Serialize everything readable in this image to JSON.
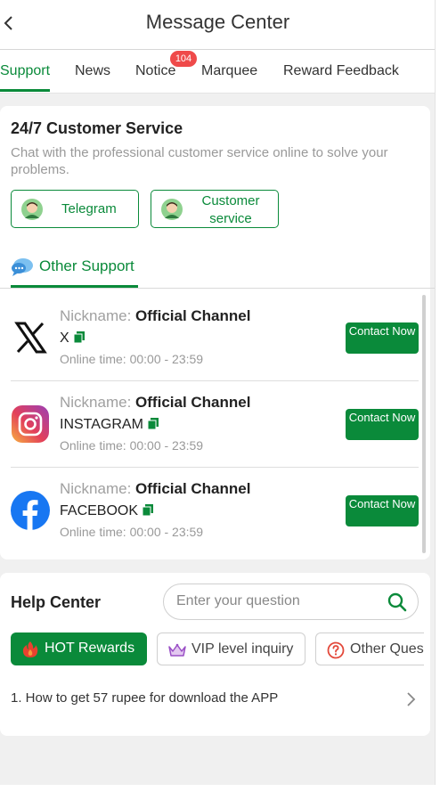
{
  "header": {
    "title": "Message Center"
  },
  "tabs": [
    {
      "label": "Support"
    },
    {
      "label": "News"
    },
    {
      "label": "Notice",
      "badge": "104"
    },
    {
      "label": "Marquee"
    },
    {
      "label": "Reward Feedback"
    }
  ],
  "support": {
    "title": "24/7 Customer Service",
    "description": "Chat with the professional customer service online to solve your problems.",
    "buttons": [
      {
        "label": "Telegram"
      },
      {
        "label": "Customer service"
      }
    ],
    "other_support_label": "Other Support",
    "channels": [
      {
        "nickname_key": "Nickname:",
        "nickname": "Official Channel",
        "name": "X",
        "online": "Online time: 00:00 - 23:59",
        "contact": "Contact Now"
      },
      {
        "nickname_key": "Nickname:",
        "nickname": "Official Channel",
        "name": "INSTAGRAM",
        "online": "Online time: 00:00 - 23:59",
        "contact": "Contact Now"
      },
      {
        "nickname_key": "Nickname:",
        "nickname": "Official Channel",
        "name": "FACEBOOK",
        "online": "Online time: 00:00 - 23:59",
        "contact": "Contact Now"
      }
    ]
  },
  "help": {
    "title": "Help Center",
    "search_placeholder": "Enter your question",
    "chips": [
      {
        "label": "HOT Rewards"
      },
      {
        "label": "VIP level inquiry"
      },
      {
        "label": "Other Questions"
      }
    ],
    "faq": [
      {
        "text": "1. How to get 57 rupee for download the APP"
      }
    ]
  },
  "colors": {
    "accent": "#0a8a3a",
    "badge": "#ef4a4a",
    "background": "#f0f0f0"
  }
}
